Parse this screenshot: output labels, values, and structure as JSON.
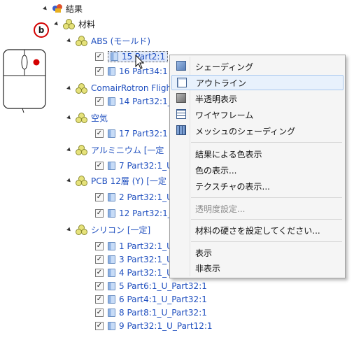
{
  "tree": {
    "results_label": "結果",
    "materials_label": "材料",
    "marker_label": "b",
    "groups": [
      {
        "label": "ABS (モールド)",
        "items": [
          "15 Part2:1",
          "16 Part34:1"
        ]
      },
      {
        "label": "ComairRotron Fligh",
        "items": [
          "14 Part32:1_"
        ]
      },
      {
        "label": "空気",
        "items": [
          "17 Part32:1"
        ]
      },
      {
        "label": "アルミニウム [一定",
        "items": [
          "7 Part32:1_U"
        ]
      },
      {
        "label": "PCB 12層 (Y) [一定",
        "items": [
          "2 Part32:1_U",
          "12 Part32:1_"
        ]
      },
      {
        "label": "シリコン [一定]",
        "items": [
          "1 Part32:1_U",
          "3 Part32:1_U",
          "4 Part32:1_U",
          "5 Part6:1_U_Part32:1",
          "6 Part4:1_U_Part32:1",
          "8 Part8:1_U_Part32:1",
          "9 Part32:1_U_Part12:1"
        ]
      }
    ]
  },
  "context_menu": {
    "items": [
      {
        "label": "シェーディング",
        "icon": "shading-icon"
      },
      {
        "label": "アウトライン",
        "icon": "outline-icon",
        "highlighted": true
      },
      {
        "label": "半透明表示",
        "icon": "translucent-icon"
      },
      {
        "label": "ワイヤフレーム",
        "icon": "wireframe-icon"
      },
      {
        "label": "メッシュのシェーディング",
        "icon": "mesh-shading-icon"
      },
      {
        "label": "結果による色表示"
      },
      {
        "label": "色の表示..."
      },
      {
        "label": "テクスチャの表示..."
      },
      {
        "label": "透明度設定...",
        "disabled": true
      },
      {
        "label": "材料の硬さを設定してください..."
      },
      {
        "label": "表示"
      },
      {
        "label": "非表示"
      }
    ]
  },
  "colors": {
    "link_blue": "#1f4fbf",
    "marker_red": "#d40000",
    "highlight": "#e8f1fc"
  }
}
